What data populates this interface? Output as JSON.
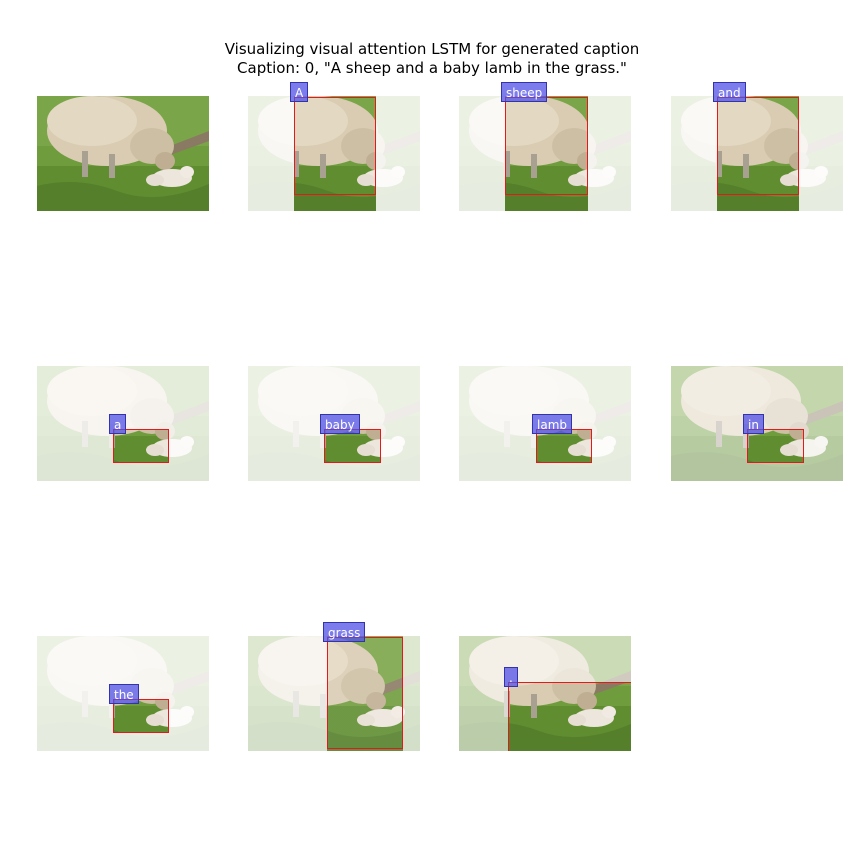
{
  "title": {
    "line1": "Visualizing visual attention LSTM for generated caption",
    "line2": "Caption: 0, \"A sheep and a baby lamb in the grass.\""
  },
  "panels": [
    {
      "word": "",
      "kind": "original"
    },
    {
      "word": "A",
      "kind": "attention"
    },
    {
      "word": "sheep",
      "kind": "attention"
    },
    {
      "word": "and",
      "kind": "attention"
    },
    {
      "word": "a",
      "kind": "attention"
    },
    {
      "word": "baby",
      "kind": "attention"
    },
    {
      "word": "lamb",
      "kind": "attention"
    },
    {
      "word": "in",
      "kind": "attention"
    },
    {
      "word": "the",
      "kind": "attention"
    },
    {
      "word": "grass",
      "kind": "attention"
    },
    {
      "word": ".",
      "kind": "attention"
    }
  ],
  "colors": {
    "box": "#e31a1c",
    "tag_bg": "#5050e6",
    "grass": "#6b9a3a",
    "wool": "#d8cbb2"
  }
}
